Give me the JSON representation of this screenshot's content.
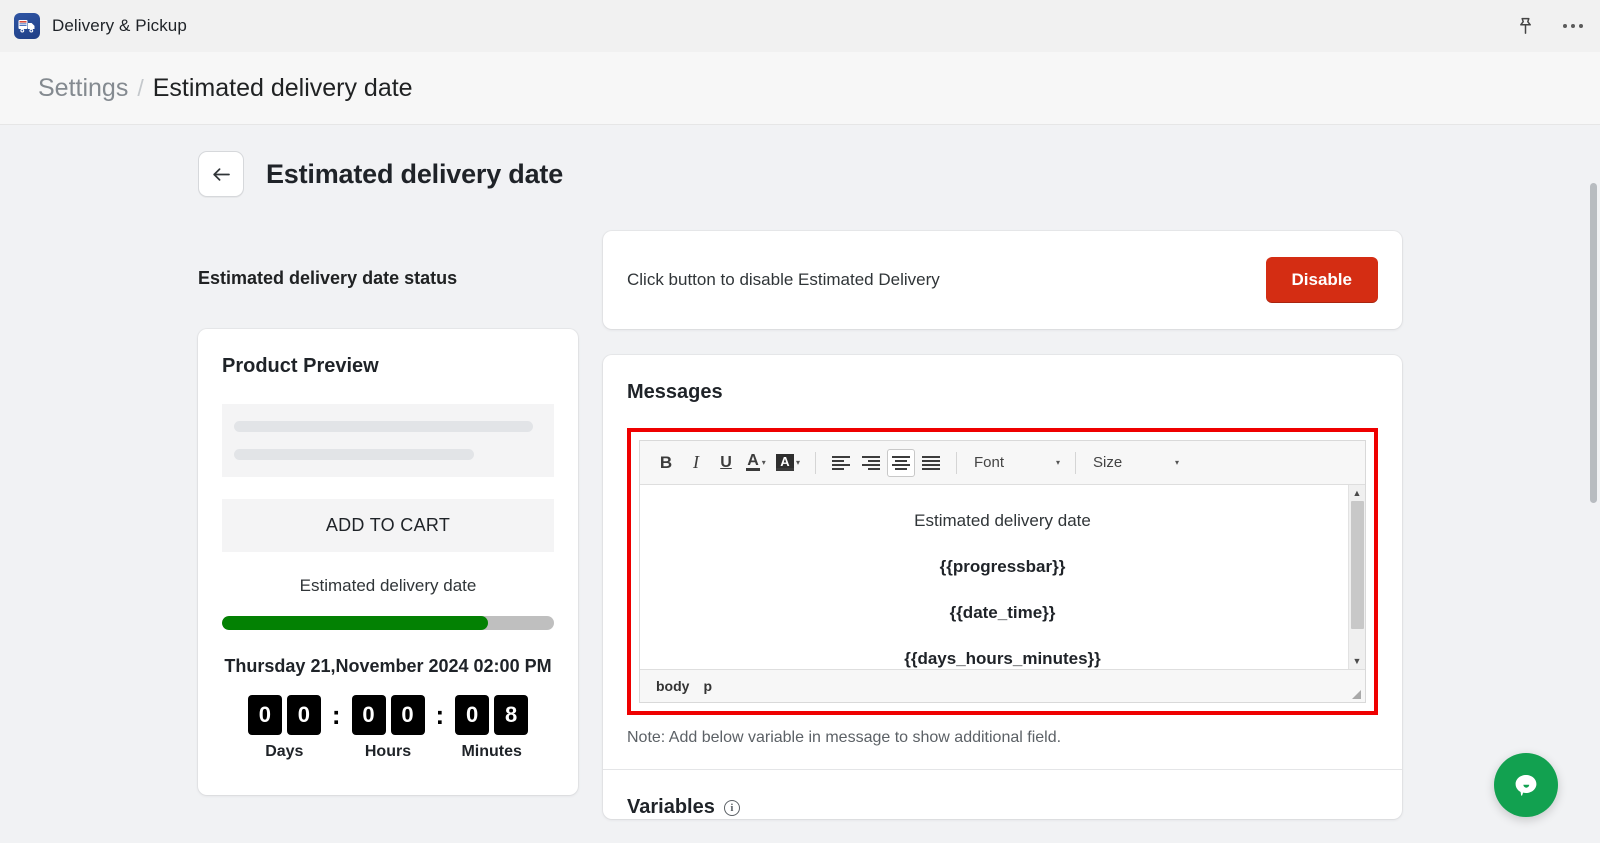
{
  "appbar": {
    "app_name": "Delivery & Pickup",
    "app_icon": "delivery-truck-icon",
    "pin_icon": "pin-icon",
    "more_icon": "more-ellipsis-icon"
  },
  "breadcrumb": {
    "parent": "Settings",
    "separator": "/",
    "current": "Estimated delivery date"
  },
  "page": {
    "back_icon": "←",
    "title": "Estimated delivery date"
  },
  "status_section": {
    "label": "Estimated delivery date status",
    "message": "Click button to disable Estimated Delivery",
    "button_label": "Disable",
    "button_color": "#d42d13"
  },
  "product_preview": {
    "title": "Product Preview",
    "add_to_cart_label": "ADD TO CART",
    "edd_label": "Estimated delivery date",
    "progress_percent": 80,
    "progress_fill_color": "#038103",
    "progress_track_color": "#bfbfbf",
    "date_text": "Thursday 21,November 2024 02:00 PM",
    "countdown": [
      {
        "digits": [
          "0",
          "0"
        ],
        "name": "Days"
      },
      {
        "digits": [
          "0",
          "0"
        ],
        "name": "Hours"
      },
      {
        "digits": [
          "0",
          "8"
        ],
        "name": "Minutes"
      }
    ],
    "colon": ":"
  },
  "messages": {
    "title": "Messages",
    "toolbar": {
      "bold": "B",
      "italic": "I",
      "underline": "U",
      "font_color": "A",
      "background_color": "A",
      "caret": "▾",
      "align_left_icon": "align-left-icon",
      "align_right_icon": "align-right-icon",
      "align_center_icon": "align-center-icon",
      "align_justify_icon": "align-justify-icon",
      "active_align": "align-center",
      "font_select": "Font",
      "size_select": "Size"
    },
    "content_lines": [
      {
        "text": "Estimated delivery date",
        "bold": false
      },
      {
        "text": "{{progressbar}}",
        "bold": true
      },
      {
        "text": "{{date_time}}",
        "bold": true
      },
      {
        "text": "{{days_hours_minutes}}",
        "bold": true
      }
    ],
    "status_path": [
      "body",
      "p"
    ],
    "highlight_color": "#ef0000",
    "scrollbar": {
      "up_arrow": "▲",
      "down_arrow": "▼"
    },
    "note": "Note: Add below variable in message to show additional field."
  },
  "variables": {
    "title": "Variables",
    "info_icon": "ⓘ",
    "info_glyph": "i"
  },
  "chat": {
    "icon": "chat-bubble-icon",
    "color": "#12a150"
  }
}
